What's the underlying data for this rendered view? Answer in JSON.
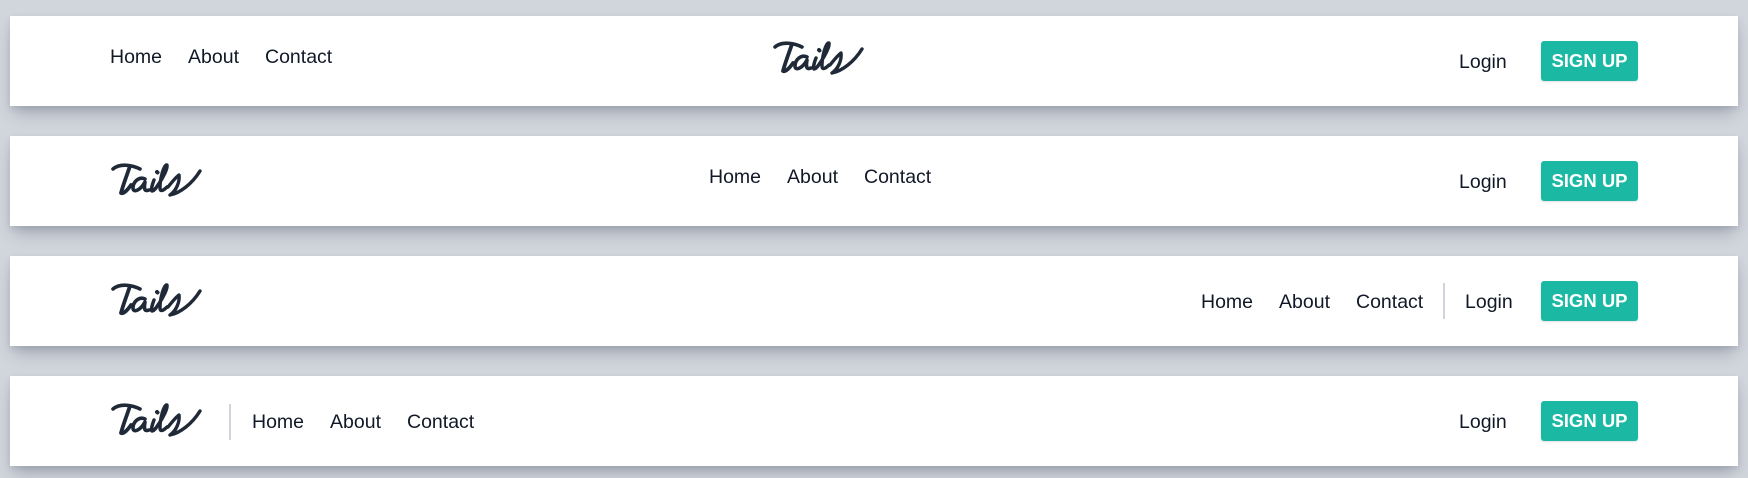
{
  "brand": {
    "logo_text": "tails",
    "accent_color": "#1bb8a3",
    "text_color": "#111827"
  },
  "navbars": [
    {
      "links": [
        "Home",
        "About",
        "Contact"
      ],
      "login_label": "Login",
      "signup_label": "SIGN UP"
    },
    {
      "links": [
        "Home",
        "About",
        "Contact"
      ],
      "login_label": "Login",
      "signup_label": "SIGN UP"
    },
    {
      "links": [
        "Home",
        "About",
        "Contact"
      ],
      "login_label": "Login",
      "signup_label": "SIGN UP"
    },
    {
      "links": [
        "Home",
        "About",
        "Contact"
      ],
      "login_label": "Login",
      "signup_label": "SIGN UP"
    }
  ]
}
